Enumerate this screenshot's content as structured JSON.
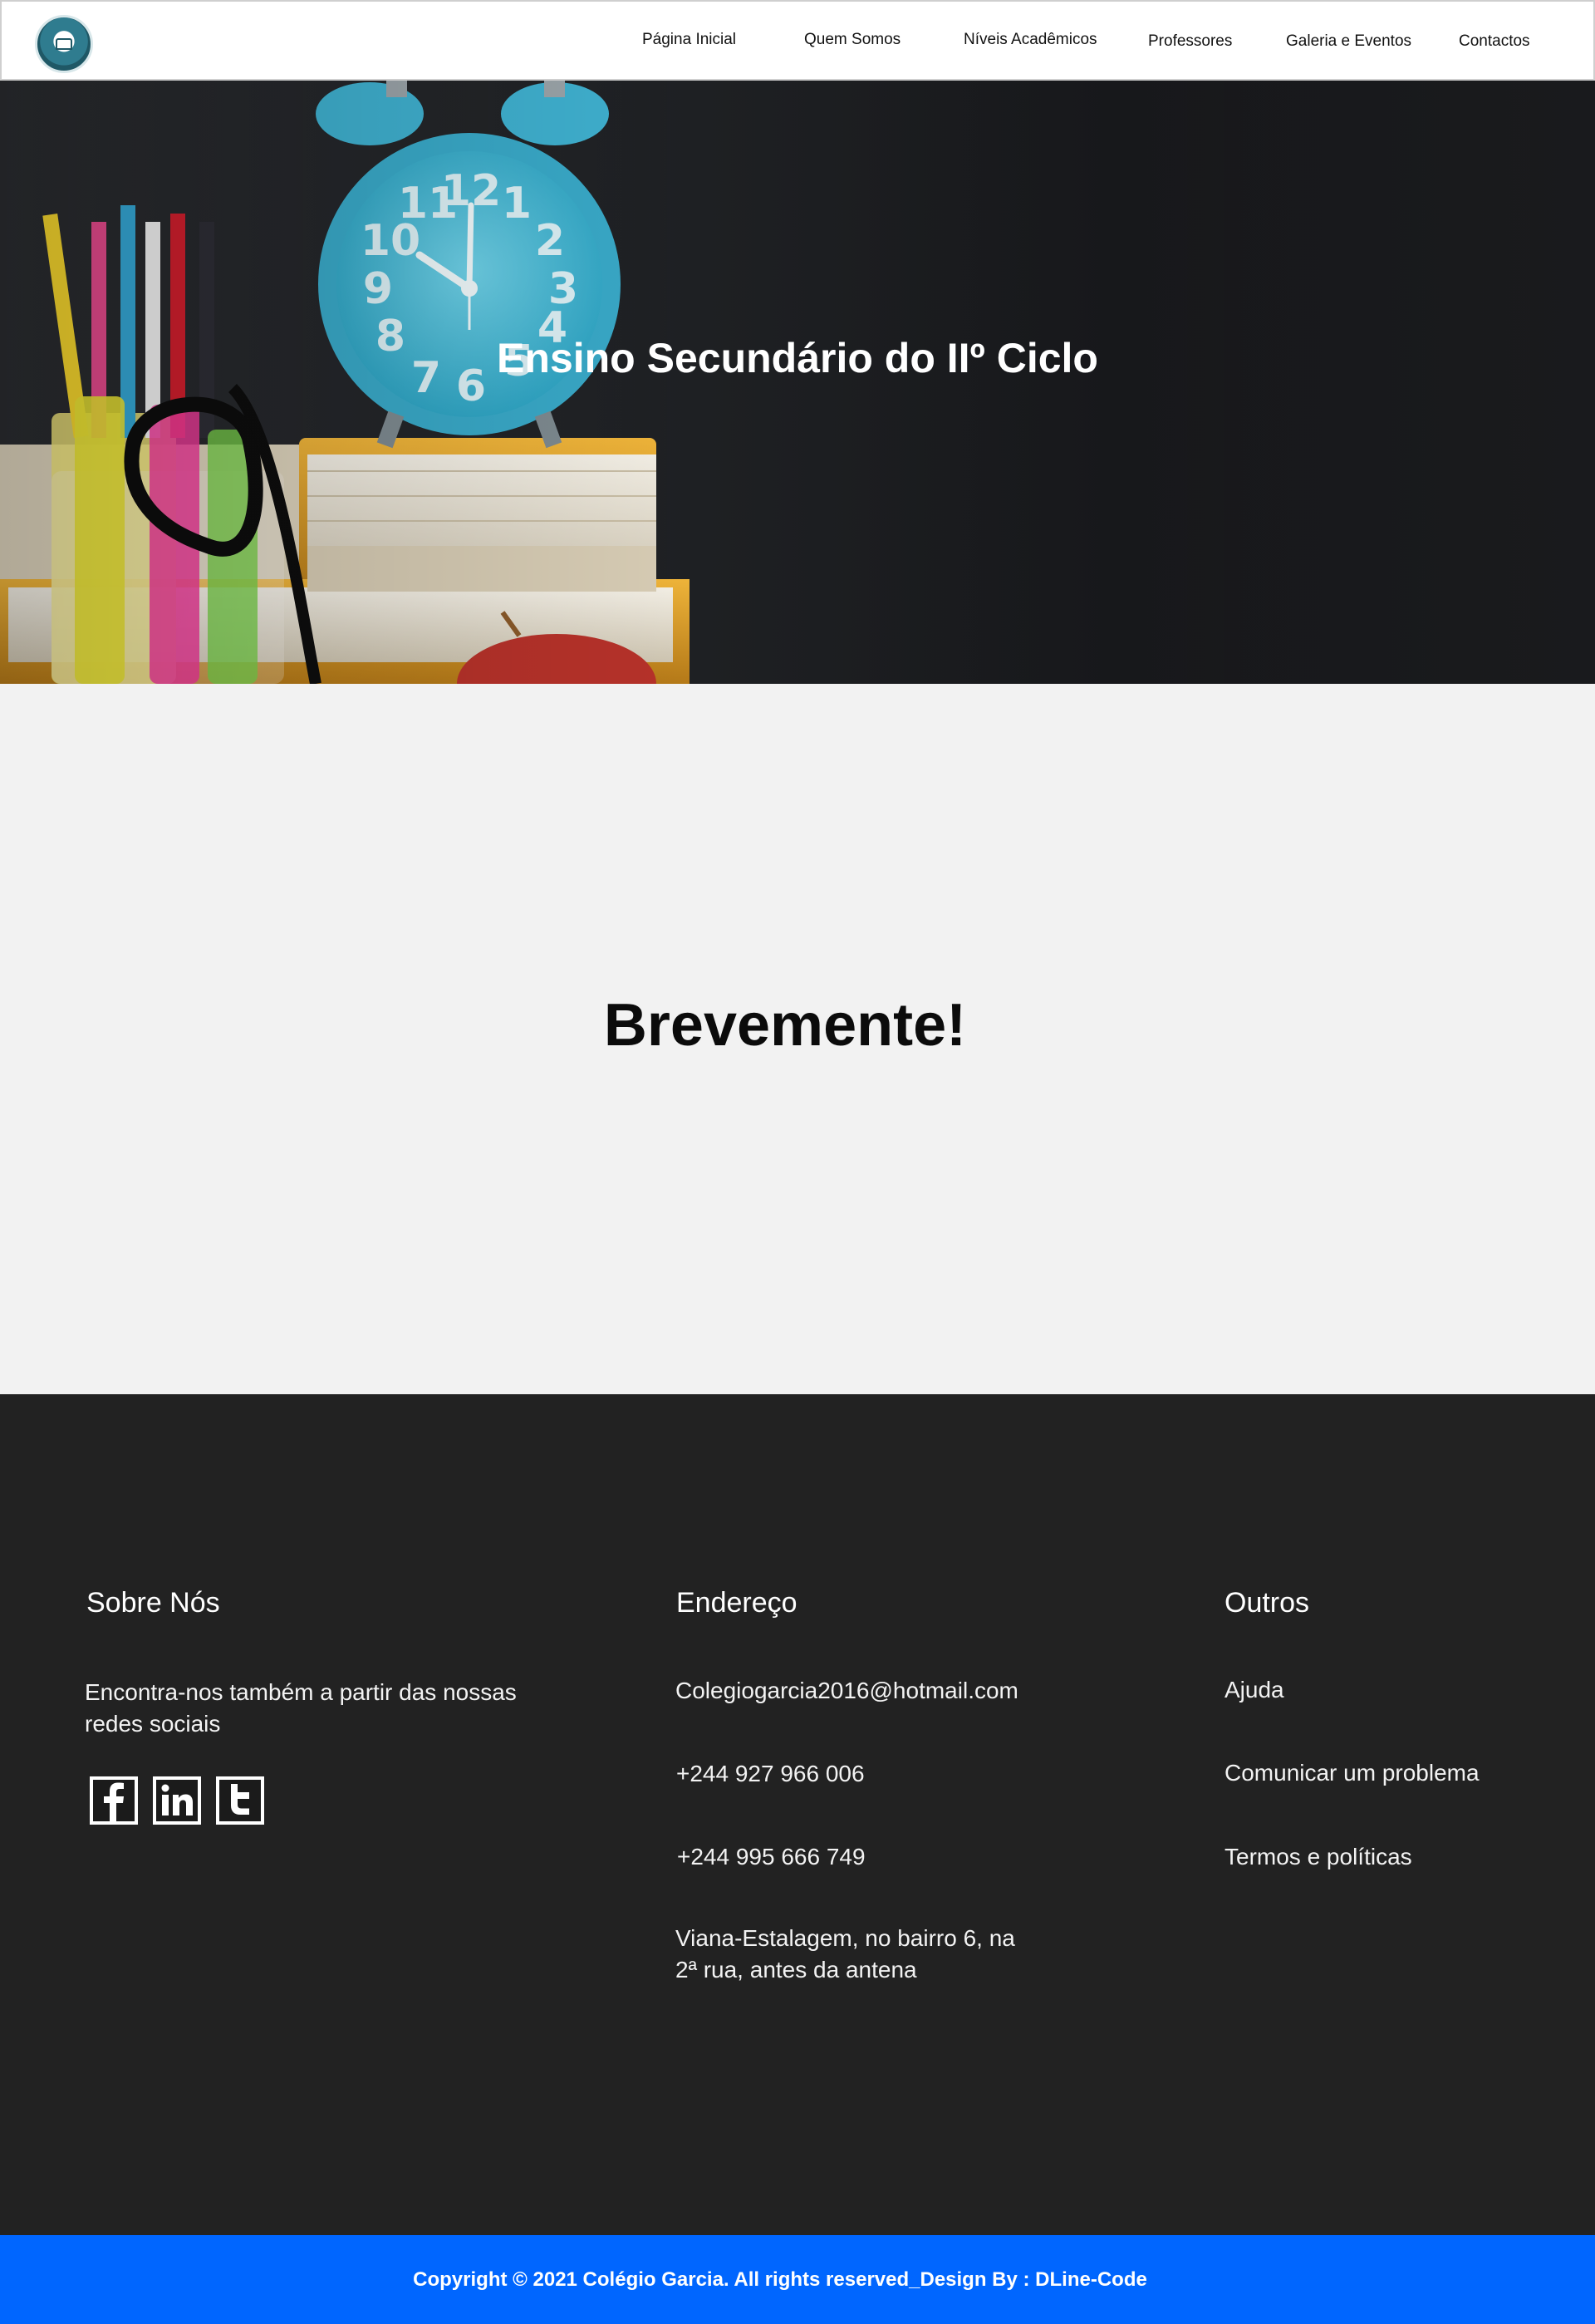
{
  "nav": {
    "items": [
      {
        "label": "Página Inicial"
      },
      {
        "label": "Quem Somos"
      },
      {
        "label": "Níveis Acadêmicos"
      },
      {
        "label": "Professores"
      },
      {
        "label": "Galeria e Eventos"
      },
      {
        "label": "Contactos"
      }
    ]
  },
  "hero": {
    "title": "Ensino Secundário do IIº Ciclo",
    "clock_numbers": [
      "11",
      "12",
      "1",
      "10",
      "2",
      "9",
      "3",
      "8",
      "4",
      "7",
      "6",
      "5"
    ]
  },
  "main": {
    "message": "Brevemente!"
  },
  "footer": {
    "about": {
      "heading": "Sobre Nós",
      "text": "Encontra-nos também a partir das nossas redes sociais",
      "social": [
        "facebook-icon",
        "linkedin-icon",
        "twitter-icon"
      ]
    },
    "address": {
      "heading": "Endereço",
      "email": "Colegiogarcia2016@hotmail.com",
      "phone1": "+244 927 966 006",
      "phone2": "+244 995 666 749",
      "location": "Viana-Estalagem, no  bairro 6, na 2ª rua, antes da antena"
    },
    "others": {
      "heading": "Outros",
      "links": [
        {
          "label": "Ajuda"
        },
        {
          "label": "Comunicar um problema"
        },
        {
          "label": "Termos e políticas"
        }
      ]
    }
  },
  "copyright": "Copyright © 2021 Colégio Garcia. All rights reserved_Design By : DLine-Code",
  "colors": {
    "footer_bg": "#222222",
    "copyright_bg": "#0066ff",
    "content_bg": "#f2f2f2"
  }
}
